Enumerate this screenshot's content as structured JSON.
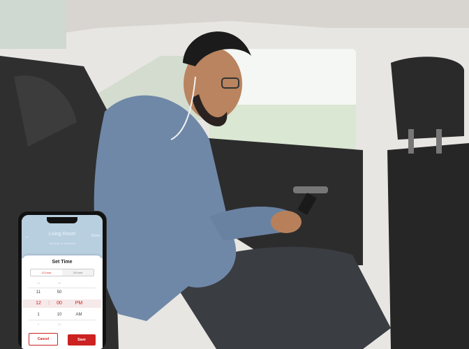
{
  "colors": {
    "accent": "#cc2222",
    "header": "#b8cfe0"
  },
  "phone_app": {
    "header": {
      "back_icon": "arrow-left-icon",
      "back_glyph": "←",
      "title": "Living Room",
      "action": "Done",
      "subtitle": "Set timer or schedule"
    },
    "sheet": {
      "title": "Set Time",
      "tabs": [
        "12-hour",
        "24-hour"
      ],
      "wheel_rows": [
        {
          "hour": "10",
          "minute": "40",
          "period": ""
        },
        {
          "hour": "11",
          "minute": "50",
          "period": ""
        },
        {
          "hour": "12",
          "minute": "00",
          "period": "PM"
        },
        {
          "hour": "1",
          "minute": "10",
          "period": "AM"
        },
        {
          "hour": "2",
          "minute": "20",
          "period": ""
        }
      ],
      "separator": ":",
      "cancel_label": "Cancel",
      "save_label": "Save"
    }
  }
}
